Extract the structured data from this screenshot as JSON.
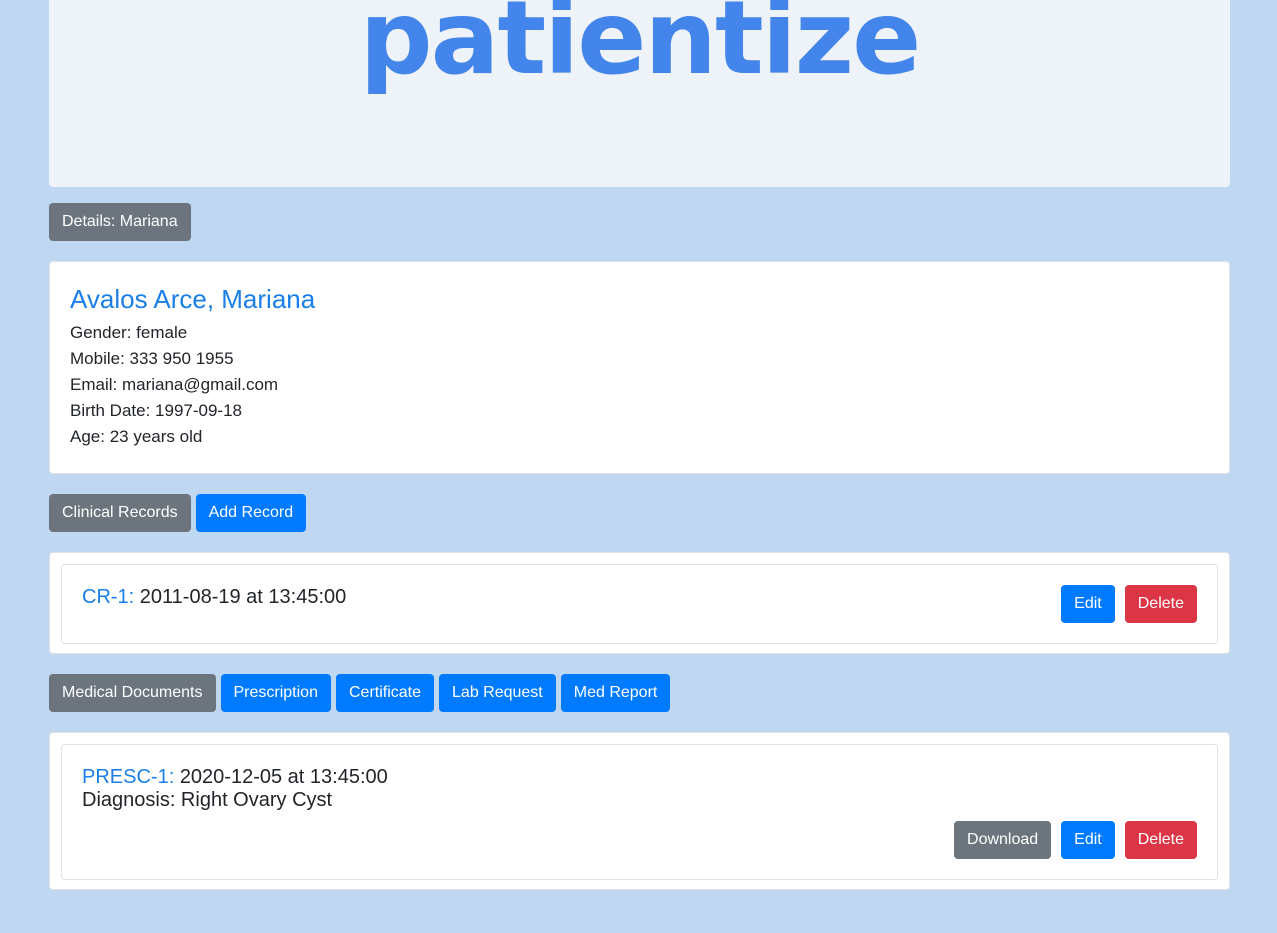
{
  "header": {
    "logo_text": "patientize"
  },
  "details_section": {
    "label": "Details: Mariana"
  },
  "patient": {
    "name": "Avalos Arce, Mariana",
    "gender": "Gender: female",
    "mobile": "Mobile: 333 950 1955",
    "email": "Email: mariana@gmail.com",
    "birth_date": "Birth Date: 1997-09-18",
    "age": "Age: 23 years old"
  },
  "clinical_records": {
    "label": "Clinical Records",
    "add_label": "Add Record",
    "items": [
      {
        "id": "CR-1:",
        "datetime": "2011-08-19 at 13:45:00",
        "edit_label": "Edit",
        "delete_label": "Delete"
      }
    ]
  },
  "medical_documents": {
    "label": "Medical Documents",
    "buttons": [
      "Prescription",
      "Certificate",
      "Lab Request",
      "Med Report"
    ],
    "items": [
      {
        "id": "PRESC-1:",
        "datetime": "2020-12-05 at 13:45:00",
        "diagnosis": "Diagnosis: Right Ovary Cyst",
        "download_label": "Download",
        "edit_label": "Edit",
        "delete_label": "Delete"
      }
    ]
  },
  "colors": {
    "background": "#c0d7f1",
    "primary": "#007bff",
    "secondary": "#6c757d",
    "danger": "#dc3545",
    "logo": "#4385ea",
    "link": "#1a7fe8"
  }
}
